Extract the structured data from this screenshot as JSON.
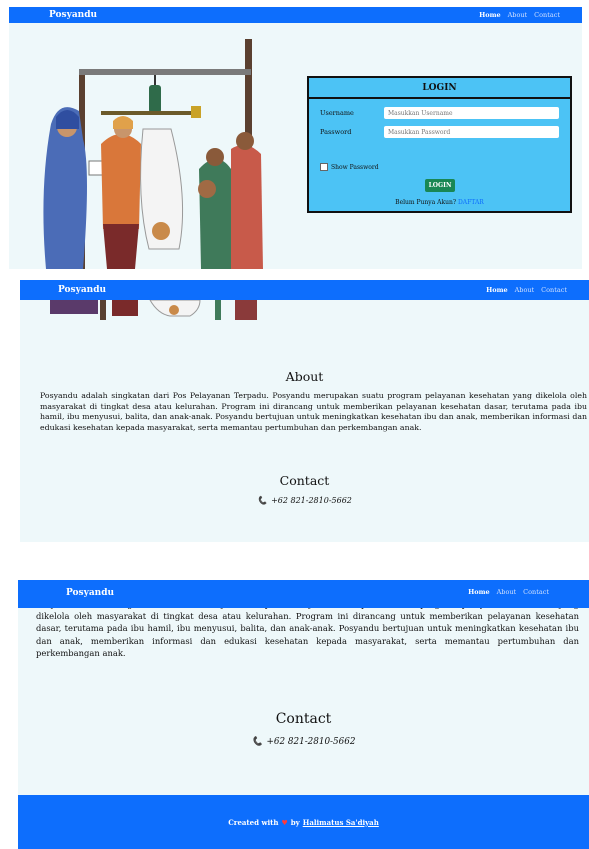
{
  "brand": "Posyandu",
  "nav": {
    "home": "Home",
    "about": "About",
    "contact": "Contact"
  },
  "login": {
    "title": "LOGIN",
    "username_label": "Username",
    "username_placeholder": "Masukkan Username",
    "password_label": "Password",
    "password_placeholder": "Masukkan Password",
    "show_password": "Show Password",
    "button": "LOGIN",
    "register_prompt": "Belum Punya Akun?",
    "register_link": "DAFTAR"
  },
  "about": {
    "title": "About",
    "text": "Posyandu adalah singkatan dari Pos Pelayanan Terpadu. Posyandu merupakan suatu program pelayanan kesehatan yang dikelola oleh masyarakat di tingkat desa atau kelurahan. Program ini dirancang untuk memberikan pelayanan kesehatan dasar, terutama pada ibu hamil, ibu menyusui, balita, dan anak-anak. Posyandu bertujuan untuk meningkatkan kesehatan ibu dan anak, memberikan informasi dan edukasi kesehatan kepada masyarakat, serta memantau pertumbuhan dan perkembangan anak."
  },
  "contact": {
    "title": "Contact",
    "phone": "+62 821-2810-5662"
  },
  "footer": {
    "created_with": "Created with",
    "by": "by",
    "author": "Halimatus Sa'diyah"
  },
  "colors": {
    "nav": "#0d6efd",
    "panel_bg": "#eef8fa",
    "login_bg": "#4cc3f5",
    "login_btn": "#198754"
  }
}
